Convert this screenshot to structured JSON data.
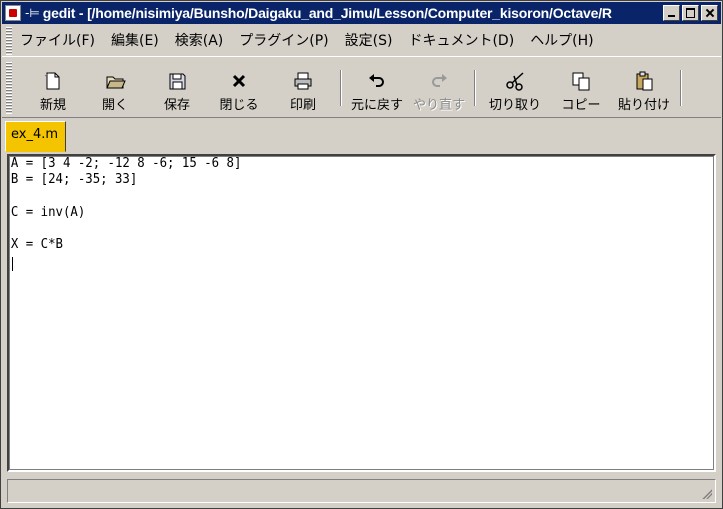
{
  "window": {
    "title": "gedit - [/home/nisimiya/Bunsho/Daigaku_and_Jimu/Lesson/Computer_kisoron/Octave/R",
    "title_icon": "gedit-app-icon",
    "pin_glyph": "-⊨"
  },
  "menu": {
    "items": [
      {
        "label": "ファイル(F)"
      },
      {
        "label": "編集(E)"
      },
      {
        "label": "検索(A)"
      },
      {
        "label": "プラグイン(P)"
      },
      {
        "label": "設定(S)"
      },
      {
        "label": "ドキュメント(D)"
      },
      {
        "label": "ヘルプ(H)"
      }
    ]
  },
  "toolbar": {
    "new": "新規",
    "open": "開く",
    "save": "保存",
    "close": "閉じる",
    "print": "印刷",
    "undo": "元に戻す",
    "redo": "やり直す",
    "cut": "切り取り",
    "copy": "コピー",
    "paste": "貼り付け"
  },
  "tabs": [
    {
      "label": "ex_4.m",
      "active": true,
      "color": "#f4c400"
    }
  ],
  "editor": {
    "lines": [
      "A = [3 4 -2; -12 8 -6; 15 -6 8]",
      "B = [24; -35; 33]",
      "",
      "C = inv(A)",
      "",
      "X = C*B",
      ""
    ]
  },
  "colors": {
    "titlebar": "#0a246a",
    "chrome": "#d4d0c8",
    "tab_active": "#f4c400"
  }
}
